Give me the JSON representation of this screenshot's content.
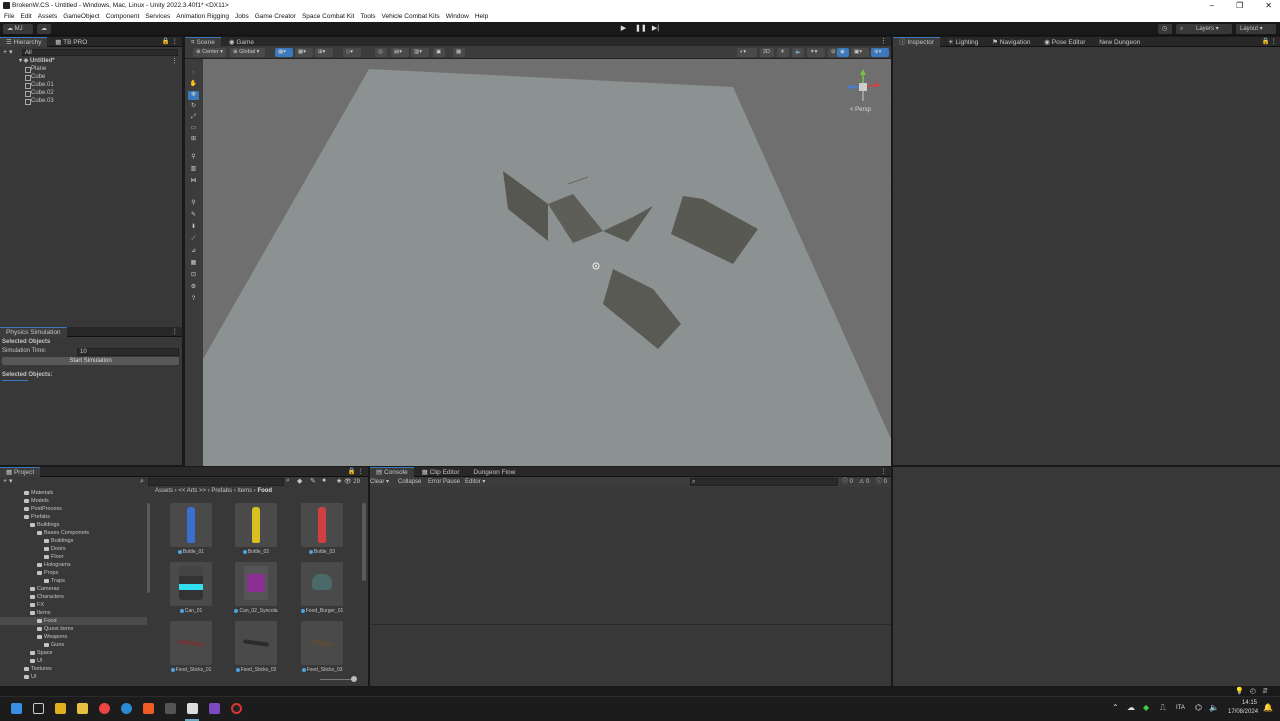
{
  "window": {
    "title": "BrokenW.CS - Untitled - Windows, Mac, Linux - Unity 2022.3.40f1* <DX11>",
    "min": "–",
    "max": "❐",
    "close": "✕"
  },
  "menu": [
    "File",
    "Edit",
    "Assets",
    "GameObject",
    "Component",
    "Services",
    "Animation Rigging",
    "Jobs",
    "Game Creator",
    "Space Combat Kit",
    "Tools",
    "Vehicle Combat Kits",
    "Window",
    "Help"
  ],
  "toolbar": {
    "account": "MJ",
    "layers": "Layers",
    "layout": "Layout"
  },
  "hierarchy": {
    "tabs": [
      "Hierarchy",
      "TB PRO"
    ],
    "search_placeholder": "All",
    "scene": "Untitled*",
    "items": [
      "Plane",
      "Cube",
      "Cube.01",
      "Cube.02",
      "Cube.03"
    ]
  },
  "physics": {
    "title": "Physics Simulation",
    "selected_objects_heading": "Selected Objects",
    "sim_time_label": "Simulation Time:",
    "sim_time_value": "10",
    "start_button": "Start Simulation",
    "selected_objects_label": "Selected Objects:"
  },
  "scene_view": {
    "tabs": [
      "Scene",
      "Game"
    ],
    "pivot": "Center",
    "space": "Global",
    "mode_2d": "2D",
    "persp": "< Persp"
  },
  "inspector": {
    "tabs": [
      "Inspector",
      "Lighting",
      "Navigation",
      "Pose Editor",
      "New Dungeon"
    ]
  },
  "project": {
    "title": "Project",
    "breadcrumb": [
      "Assets",
      "<< Arts >>",
      "Prefabs",
      "Items",
      "Food"
    ],
    "count": "29",
    "tree": [
      {
        "label": "Materials",
        "indent": 0
      },
      {
        "label": "Models",
        "indent": 0
      },
      {
        "label": "PostProcess",
        "indent": 0
      },
      {
        "label": "Prefabs",
        "indent": 0
      },
      {
        "label": "Buildings",
        "indent": 1
      },
      {
        "label": "Bases Componets",
        "indent": 2
      },
      {
        "label": "Buildings",
        "indent": 3
      },
      {
        "label": "Doors",
        "indent": 3
      },
      {
        "label": "Floor",
        "indent": 3
      },
      {
        "label": "Holograms",
        "indent": 2
      },
      {
        "label": "Props",
        "indent": 2
      },
      {
        "label": "Traps",
        "indent": 3
      },
      {
        "label": "Cameras",
        "indent": 1
      },
      {
        "label": "Characters",
        "indent": 1
      },
      {
        "label": "FX",
        "indent": 1
      },
      {
        "label": "Items",
        "indent": 1
      },
      {
        "label": "Food",
        "indent": 2
      },
      {
        "label": "Quest items",
        "indent": 2
      },
      {
        "label": "Weapons",
        "indent": 2
      },
      {
        "label": "Guns",
        "indent": 3
      },
      {
        "label": "Space",
        "indent": 1
      },
      {
        "label": "UI",
        "indent": 1
      },
      {
        "label": "Textures",
        "indent": 0
      },
      {
        "label": "UI",
        "indent": 0
      }
    ],
    "assets": [
      {
        "label": "Bottle_01",
        "color": "#3a6fd0"
      },
      {
        "label": "Bottle_02",
        "color": "#d8c020"
      },
      {
        "label": "Bottle_03",
        "color": "#d04040"
      },
      {
        "label": "Can_01",
        "color": "#30e0f0"
      },
      {
        "label": "Can_02_Syncola",
        "color": "#8a3090"
      },
      {
        "label": "Food_Burger_01",
        "color": "#4a6a6a"
      },
      {
        "label": "Food_Sticks_01",
        "color": "#6a3a3a"
      },
      {
        "label": "Food_Sticks_02",
        "color": "#3a3a3a"
      },
      {
        "label": "Food_Sticks_03",
        "color": "#5a4a3a"
      }
    ]
  },
  "console": {
    "tabs": [
      "Console",
      "Clip Editor",
      "Dungeon Flow"
    ],
    "clear": "Clear",
    "collapse": "Collapse",
    "error_pause": "Error Pause",
    "editor": "Editor",
    "counts": [
      "0",
      "0",
      "0"
    ]
  },
  "taskbar": {
    "lang": "ITA",
    "time": "14:15",
    "date": "17/08/2024"
  },
  "colors": {
    "accent": "#3a79bb",
    "scene_bg": "#6f6f6f",
    "plane": "#8c9191"
  }
}
